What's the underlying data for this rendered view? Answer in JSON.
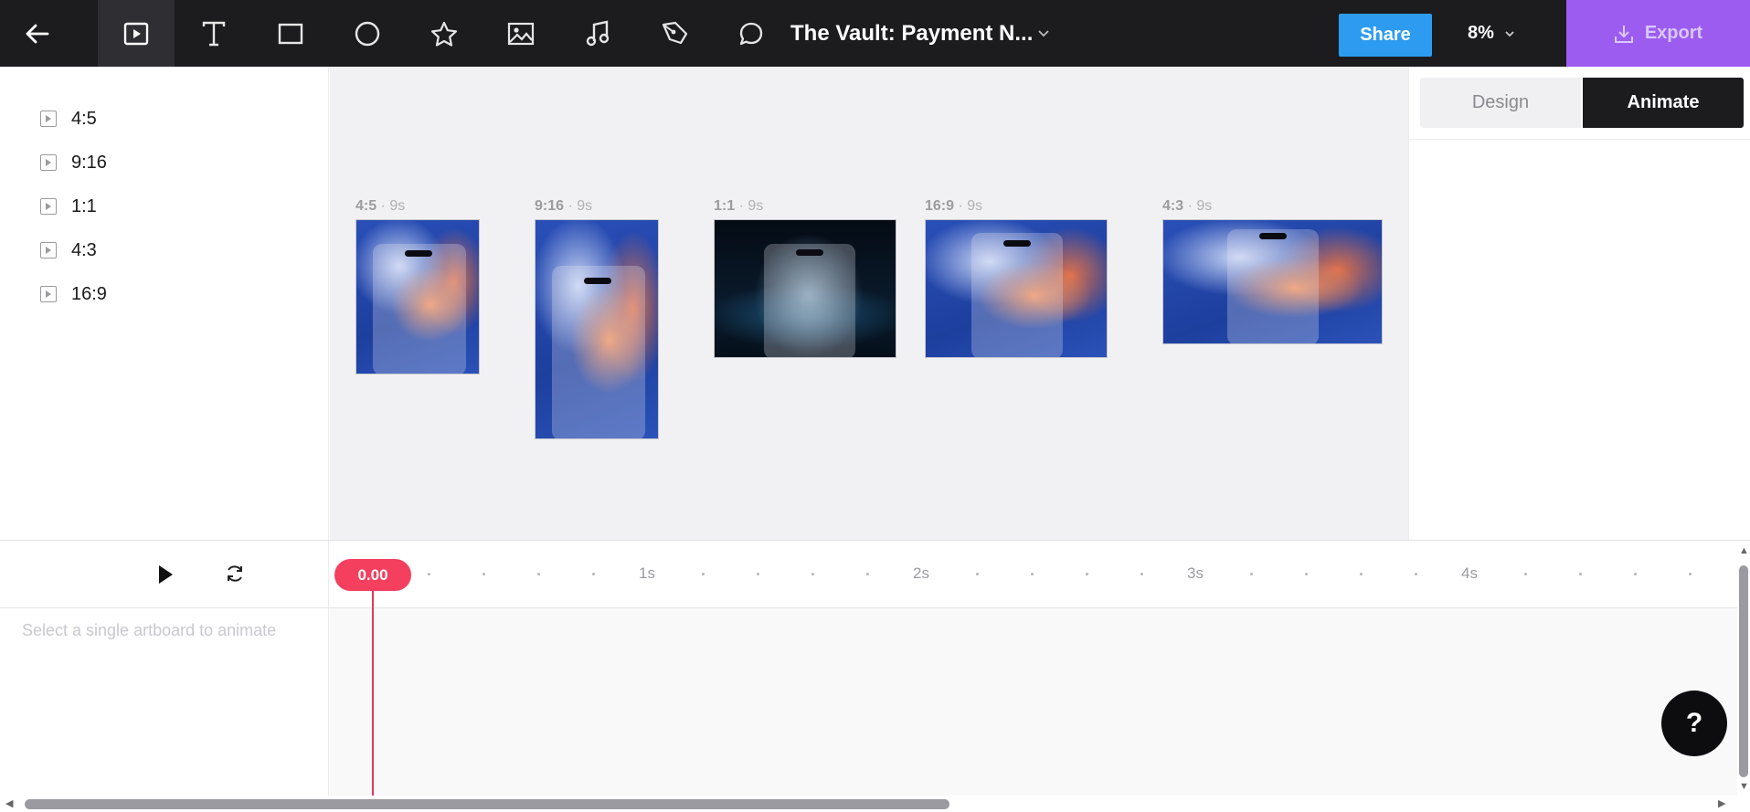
{
  "toolbar": {
    "title": "The Vault: Payment N...",
    "share_label": "Share",
    "zoom_label": "8%",
    "export_label": "Export",
    "tools": [
      "back-arrow-icon",
      "artboard-icon",
      "text-icon",
      "rectangle-icon",
      "ellipse-icon",
      "star-icon",
      "image-icon",
      "music-icon",
      "pen-icon",
      "comment-icon"
    ]
  },
  "artboards_list": {
    "items": [
      {
        "label": "4:5"
      },
      {
        "label": "9:16"
      },
      {
        "label": "1:1"
      },
      {
        "label": "4:3"
      },
      {
        "label": "16:9"
      }
    ]
  },
  "canvas": {
    "artboards": [
      {
        "ratio": "4:5",
        "duration": "9s",
        "style": "flame"
      },
      {
        "ratio": "9:16",
        "duration": "9s",
        "style": "flame"
      },
      {
        "ratio": "1:1",
        "duration": "9s",
        "style": "space"
      },
      {
        "ratio": "16:9",
        "duration": "9s",
        "style": "flame"
      },
      {
        "ratio": "4:3",
        "duration": "9s",
        "style": "flame"
      }
    ]
  },
  "right_panel": {
    "tabs": [
      {
        "label": "Design",
        "active": false
      },
      {
        "label": "Animate",
        "active": true
      }
    ]
  },
  "timeline": {
    "current_time": "0.00",
    "seconds": [
      "1s",
      "2s",
      "3s",
      "4s"
    ],
    "hint": "Select a single artboard to animate"
  },
  "help": {
    "label": "?"
  },
  "colors": {
    "toolbar_bg": "#1c1c1f",
    "share": "#2d9cf0",
    "export": "#9c5cf0",
    "playhead": "#f43f5e"
  }
}
